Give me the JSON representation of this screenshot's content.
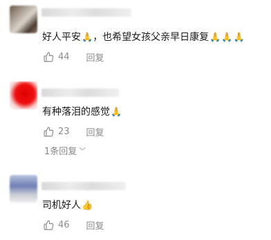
{
  "comments": [
    {
      "text": "好人平安",
      "text_rest": "，也希望女孩父亲早日康复",
      "emoji_pray": "🙏",
      "likes": "44",
      "reply_label": "回复"
    },
    {
      "text": "有种落泪的感觉",
      "emoji_pray": "🙏",
      "likes": "23",
      "reply_label": "回复",
      "replies_link": "1条回复",
      "replies_chevron": "﹀"
    },
    {
      "text": "司机好人",
      "emoji_thumb": "👍",
      "likes": "46",
      "reply_label": "回复"
    }
  ]
}
